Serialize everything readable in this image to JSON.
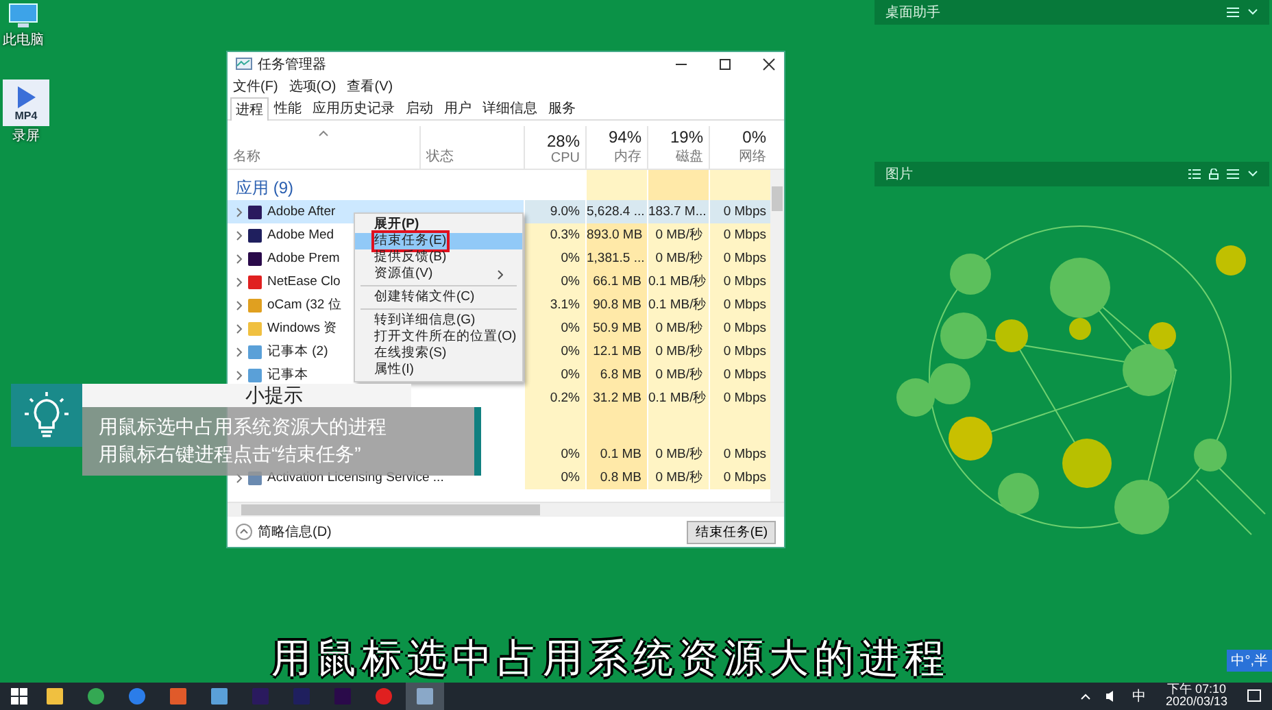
{
  "desktop_icons": [
    {
      "kind": "pc",
      "label": "此电脑"
    },
    {
      "kind": "video",
      "badge": "MP4",
      "label": "录屏"
    }
  ],
  "task_manager": {
    "title": "任务管理器",
    "menu": [
      "文件(F)",
      "选项(O)",
      "查看(V)"
    ],
    "tabs": [
      {
        "label": "进程",
        "selected": true
      },
      {
        "label": "性能",
        "selected": false
      },
      {
        "label": "应用历史记录",
        "selected": false
      },
      {
        "label": "启动",
        "selected": false
      },
      {
        "label": "用户",
        "selected": false
      },
      {
        "label": "详细信息",
        "selected": false
      },
      {
        "label": "服务",
        "selected": false
      }
    ],
    "columns": [
      {
        "label": "名称"
      },
      {
        "label": "状态"
      },
      {
        "percent": "28%",
        "label": "CPU"
      },
      {
        "percent": "94%",
        "label": "内存"
      },
      {
        "percent": "19%",
        "label": "磁盘"
      },
      {
        "percent": "0%",
        "label": "网络"
      }
    ],
    "group": "应用 (9)",
    "rows": [
      {
        "kind": "process",
        "name": "Adobe After",
        "cpu": "9.0%",
        "memory": "5,628.4 ...",
        "disk": "183.7 M...",
        "network": "0 Mbps",
        "selected": true
      },
      {
        "kind": "process",
        "name": "Adobe Med",
        "cpu": "0.3%",
        "memory": "893.0 MB",
        "disk": "0 MB/秒",
        "network": "0 Mbps",
        "selected": false
      },
      {
        "kind": "process",
        "name": "Adobe Prem",
        "cpu": "0%",
        "memory": "1,381.5 ...",
        "disk": "0 MB/秒",
        "network": "0 Mbps",
        "selected": false
      },
      {
        "kind": "process",
        "name": "NetEase Clo",
        "cpu": "0%",
        "memory": "66.1 MB",
        "disk": "0.1 MB/秒",
        "network": "0 Mbps",
        "selected": false
      },
      {
        "kind": "process",
        "name": "oCam (32 位",
        "cpu": "3.1%",
        "memory": "90.8 MB",
        "disk": "0.1 MB/秒",
        "network": "0 Mbps",
        "selected": false
      },
      {
        "kind": "process",
        "name": "Windows 资",
        "cpu": "0%",
        "memory": "50.9 MB",
        "disk": "0 MB/秒",
        "network": "0 Mbps",
        "selected": false
      },
      {
        "kind": "process",
        "name": "记事本 (2)",
        "cpu": "0%",
        "memory": "12.1 MB",
        "disk": "0 MB/秒",
        "network": "0 Mbps",
        "selected": false
      },
      {
        "kind": "process",
        "name": "记事本",
        "cpu": "0%",
        "memory": "6.8 MB",
        "disk": "0 MB/秒",
        "network": "0 Mbps",
        "selected": false
      },
      {
        "kind": "process",
        "cpu": "0.2%",
        "memory": "31.2 MB",
        "disk": "0.1 MB/秒",
        "network": "0 Mbps",
        "selected": false
      },
      {
        "kind": "spacer"
      },
      {
        "kind": "process",
        "cpu": "0%",
        "memory": "0.1 MB",
        "disk": "0 MB/秒",
        "network": "0 Mbps",
        "selected": false
      },
      {
        "kind": "process",
        "name": "Activation Licensing Service ...",
        "cpu": "0%",
        "memory": "0.8 MB",
        "disk": "0 MB/秒",
        "network": "0 Mbps",
        "selected": false
      }
    ],
    "context_menu": [
      {
        "kind": "item",
        "label": "展开(P)",
        "bold": true,
        "selected": false
      },
      {
        "kind": "item",
        "label": "结束任务(E)",
        "bold": false,
        "selected": true
      },
      {
        "kind": "item",
        "label": "提供反馈(B)",
        "bold": false,
        "selected": false
      },
      {
        "kind": "submenu",
        "label": "资源值(V)",
        "bold": false,
        "selected": false
      },
      {
        "kind": "separator"
      },
      {
        "kind": "item",
        "label": "创建转储文件(C)",
        "bold": false,
        "selected": false
      },
      {
        "kind": "separator"
      },
      {
        "kind": "item",
        "label": "转到详细信息(G)",
        "bold": false,
        "selected": false
      },
      {
        "kind": "item",
        "label": "打开文件所在的位置(O)",
        "bold": false,
        "selected": false
      },
      {
        "kind": "item",
        "label": "在线搜索(S)",
        "bold": false,
        "selected": false
      },
      {
        "kind": "item",
        "label": "属性(I)",
        "bold": false,
        "selected": false
      }
    ],
    "footer": {
      "details": "简略信息(D)",
      "end_task": "结束任务(E)"
    }
  },
  "tip": {
    "title": "小提示",
    "lines": [
      "用鼠标选中占用系统资源大的进程",
      "用鼠标右键进程点击“结束任务”"
    ]
  },
  "widgets": [
    {
      "kind": "empty",
      "title": "桌面助手"
    },
    {
      "kind": "picture",
      "title": "图片"
    }
  ],
  "subtitle": "用鼠标选中占用系统资源大的进程",
  "ime_bar": "中°,半",
  "taskbar": {
    "apps": [
      {
        "kind": "folder",
        "active": false
      },
      {
        "kind": "chrome",
        "active": false
      },
      {
        "kind": "browser",
        "active": false
      },
      {
        "kind": "app",
        "active": false
      },
      {
        "kind": "notepad",
        "active": false
      },
      {
        "kind": "ae",
        "active": false
      },
      {
        "kind": "me",
        "active": false
      },
      {
        "kind": "pr",
        "active": false
      },
      {
        "kind": "netease",
        "active": false
      },
      {
        "kind": "taskmgr",
        "active": true
      }
    ],
    "ime": "中",
    "time": "下午 07:10",
    "date": "2020/03/13"
  }
}
